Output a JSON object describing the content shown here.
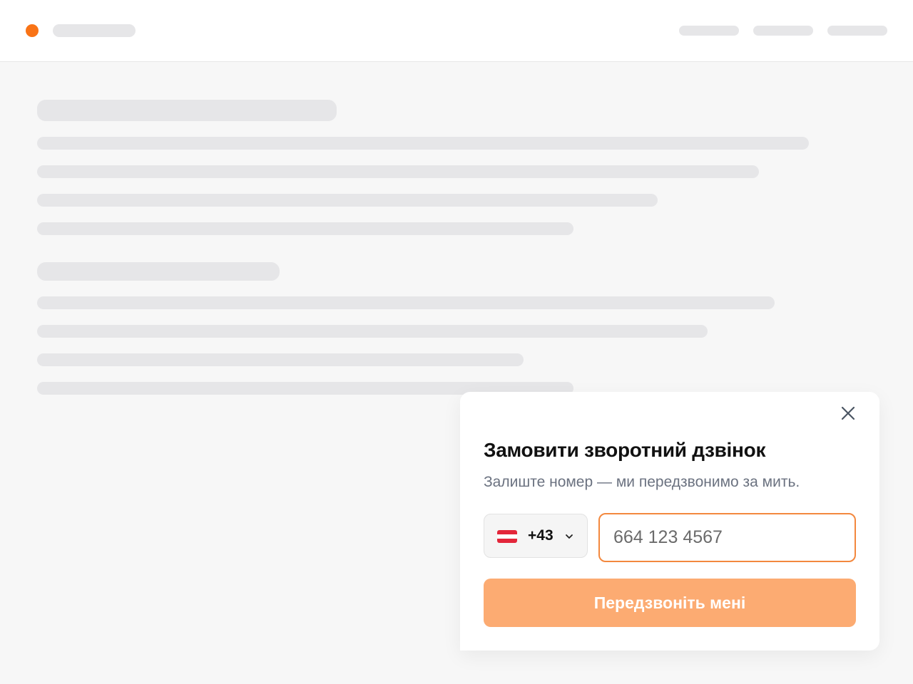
{
  "colors": {
    "accent": "#f97316",
    "button_bg": "#fcab72",
    "input_border": "#f3883e",
    "page_bg": "#f7f7f7",
    "skeleton": "#e6e6e8"
  },
  "widget": {
    "close_icon": "close-icon",
    "title": "Замовити зворотний дзвінок",
    "subtitle": "Залиште номер — ми передзвонимо за мить.",
    "country": {
      "flag": "austria-flag-icon",
      "code": "+43",
      "chevron_icon": "chevron-down-icon"
    },
    "phone": {
      "placeholder": "664 123 4567",
      "value": ""
    },
    "submit_label": "Передзвоніть мені"
  }
}
